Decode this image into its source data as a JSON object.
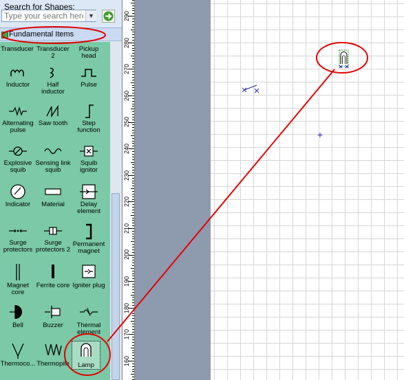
{
  "search": {
    "label": "Search for Shapes:",
    "placeholder": "Type your search here",
    "dropdown_icon": "chevron-down-icon",
    "go_icon": "arrow-right-icon"
  },
  "stencil": {
    "title": "Fundamental Items",
    "shapes": [
      {
        "label": "Transducer",
        "icon": "transducer-icon"
      },
      {
        "label": "Transducer 2",
        "icon": "transducer-2-icon"
      },
      {
        "label": "Pickup head",
        "icon": "pickup-head-icon"
      },
      {
        "label": "Inductor",
        "icon": "inductor-icon"
      },
      {
        "label": "Half inductor",
        "icon": "half-inductor-icon"
      },
      {
        "label": "Pulse",
        "icon": "pulse-icon"
      },
      {
        "label": "Alternating pulse",
        "icon": "alternating-pulse-icon"
      },
      {
        "label": "Saw tooth",
        "icon": "saw-tooth-icon"
      },
      {
        "label": "Step function",
        "icon": "step-function-icon"
      },
      {
        "label": "Explosive squib",
        "icon": "explosive-squib-icon"
      },
      {
        "label": "Sensing link squib",
        "icon": "sensing-link-squib-icon"
      },
      {
        "label": "Squib ignitor",
        "icon": "squib-ignitor-icon"
      },
      {
        "label": "Indicator",
        "icon": "indicator-icon"
      },
      {
        "label": "Material",
        "icon": "material-icon"
      },
      {
        "label": "Delay element",
        "icon": "delay-element-icon"
      },
      {
        "label": "Surge protectors",
        "icon": "surge-protectors-icon"
      },
      {
        "label": "Surge protectors 2",
        "icon": "surge-protectors-2-icon"
      },
      {
        "label": "Permanent magnet",
        "icon": "permanent-magnet-icon"
      },
      {
        "label": "Magnet core",
        "icon": "magnet-core-icon"
      },
      {
        "label": "Ferrite core",
        "icon": "ferrite-core-icon"
      },
      {
        "label": "Igniter plug",
        "icon": "igniter-plug-icon"
      },
      {
        "label": "Bell",
        "icon": "bell-icon"
      },
      {
        "label": "Buzzer",
        "icon": "buzzer-icon"
      },
      {
        "label": "Thermal element",
        "icon": "thermal-element-icon"
      },
      {
        "label": "Thermoco...",
        "icon": "thermocouple-icon"
      },
      {
        "label": "Thermopile",
        "icon": "thermopile-icon"
      },
      {
        "label": "Lamp",
        "icon": "lamp-icon"
      }
    ]
  },
  "ruler": {
    "labels": [
      "290",
      "280",
      "270",
      "260",
      "250",
      "240",
      "230",
      "220",
      "210",
      "200",
      "190",
      "180",
      "170",
      "160"
    ]
  },
  "colors": {
    "stencil_bg": "#7bc9a6",
    "annotation": "#e30000",
    "canvas_outside": "#8e9aae"
  }
}
